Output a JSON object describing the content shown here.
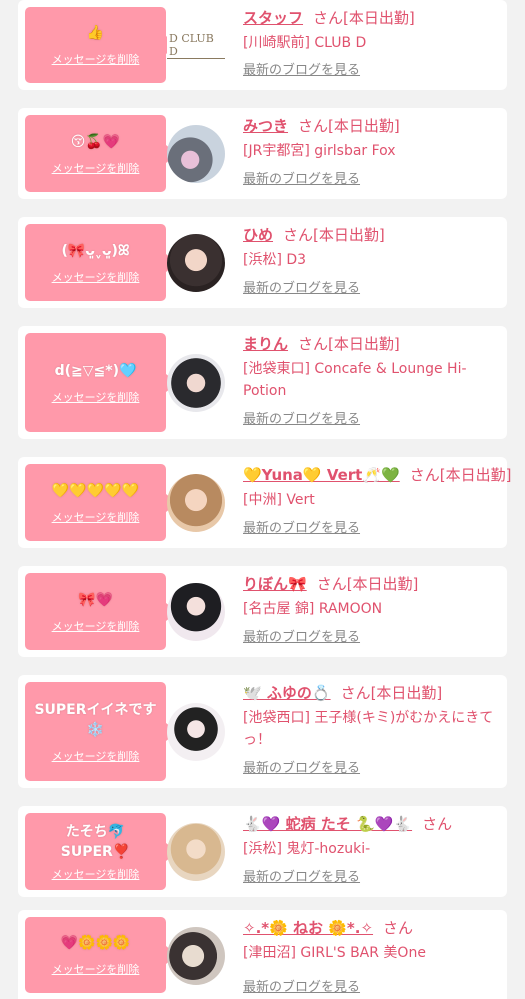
{
  "delete_label": "メッセージを削除",
  "blog_label": "最新のブログを見る",
  "cards": [
    {
      "message": "👍",
      "name": "スタッフ",
      "san": "さん[本日出勤]",
      "shop": "[川崎駅前] CLUB D",
      "avatar": "club-d-logo",
      "logo_text": "D CLUB D"
    },
    {
      "message": "😚🍒💗",
      "name": "みつき",
      "san": "さん[本日出勤]",
      "shop": "[JR宇都宮] girlsbar Fox",
      "avatar": "photo"
    },
    {
      "message": "(🎀ᴗ͈ˬᴗ͈)ꕤ",
      "name": "ひめ",
      "san": "さん[本日出勤]",
      "shop": "[浜松] D3",
      "avatar": "photo"
    },
    {
      "message": "d(≧▽≦*)🩵",
      "name": "まりん",
      "san": "さん[本日出勤]",
      "shop": "[池袋東口] Concafe & Lounge Hi-Potion",
      "avatar": "photo"
    },
    {
      "message": "💛💛💛💛💛",
      "name": "💛Yuna💛 Vert🥂💚",
      "san": "さん[本日出勤]",
      "shop": "[中洲] Vert",
      "avatar": "photo"
    },
    {
      "message": "🎀💗",
      "name": "りぼん🎀",
      "san": "さん[本日出勤]",
      "shop": "[名古屋 錦] RAMOON",
      "avatar": "photo"
    },
    {
      "message": "SUPERイイネです❄️",
      "name": "🕊️ ふゆの💍",
      "san": "さん[本日出勤]",
      "shop": "[池袋西口] 王子様(キミ)がむかえにきてっ！",
      "avatar": "photo"
    },
    {
      "message": "たそち🐬 SUPER❣️",
      "name": "🐇💜 蛇病 たそ 🐍💜🐇",
      "san": "さん",
      "shop": "[浜松] 鬼灯-hozuki-",
      "avatar": "photo"
    },
    {
      "message": "💗🌼🌼🌼",
      "name": "✧.*🌼 ねお 🌼*.✧",
      "san": "さん",
      "shop": "[津田沼] GIRL'S BAR 美One",
      "avatar": "photo"
    }
  ]
}
